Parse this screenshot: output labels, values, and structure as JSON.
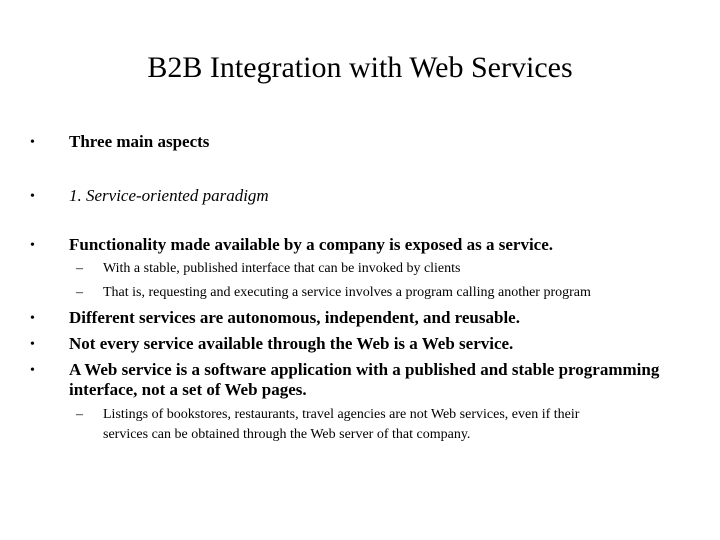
{
  "slide": {
    "title": "B2B Integration with Web Services",
    "bullets": [
      {
        "text": "Three main aspects"
      },
      {
        "text": "1. Service-oriented paradigm"
      },
      {
        "text": "Functionality made available by a company is exposed as a service."
      },
      {
        "text": "Different services are autonomous, independent, and reusable."
      },
      {
        "text": "Not every service available through the Web is a Web service."
      },
      {
        "text_line1": "A Web service is a software application with a published and stable programming",
        "text_line2": "interface, not a set of Web pages."
      }
    ],
    "sub_bullets": [
      {
        "text": "With a stable, published interface that can be invoked by clients"
      },
      {
        "text": "That is, requesting and executing a service involves a program calling another program"
      },
      {
        "text_line1": "Listings of bookstores, restaurants, travel agencies are not Web services, even if their",
        "text_line2": "services can be obtained through the Web server of that company."
      }
    ],
    "bullet_glyph": "•",
    "dash_glyph": "–"
  }
}
